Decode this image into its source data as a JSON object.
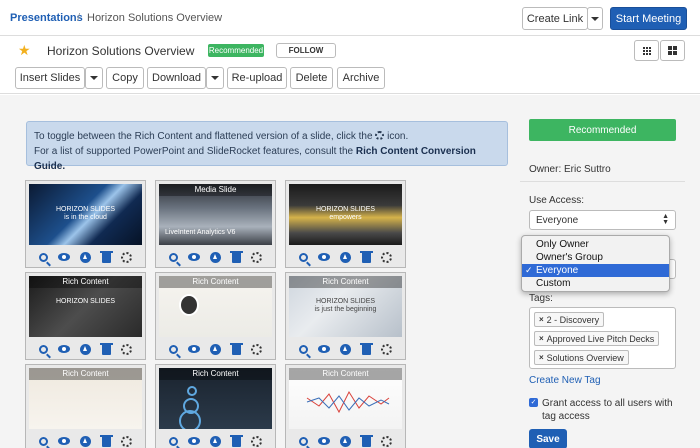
{
  "breadcrumb": {
    "root": "Presentations",
    "separator": "/",
    "current": "Horizon Solutions Overview"
  },
  "header": {
    "create_link": "Create Link",
    "start_meeting": "Start Meeting"
  },
  "presentation": {
    "title": "Horizon Solutions Overview",
    "badge": "Recommended",
    "follow": "FOLLOW"
  },
  "toolbar": {
    "insert_slides": "Insert Slides",
    "copy": "Copy",
    "download": "Download",
    "reupload": "Re-upload",
    "delete": "Delete",
    "archive": "Archive"
  },
  "info": {
    "line1_prefix": "To toggle between the Rich Content and flattened version of a slide, click the",
    "line1_suffix": "icon.",
    "line2_prefix": "For a list of supported PowerPoint and SlideRocket features, consult the",
    "line2_link": "Rich Content Conversion Guide."
  },
  "slides": [
    {
      "label": "",
      "text": "HORIZON SLIDES\nis in the cloud",
      "theme": "blue-motion"
    },
    {
      "label": "Media Slide",
      "text": "LiveIntent Analytics V6",
      "theme": "people"
    },
    {
      "label": "",
      "text": "HORIZON SLIDES\nempowers",
      "theme": "gold"
    },
    {
      "label": "Rich Content",
      "text": "HORIZON SLIDES",
      "theme": "dark-room"
    },
    {
      "label": "Rich Content",
      "text": "",
      "theme": "profile"
    },
    {
      "label": "Rich Content",
      "text": "HORIZON SLIDES\nis just the beginning",
      "theme": "blur"
    },
    {
      "label": "Rich Content",
      "text": "",
      "theme": "doc"
    },
    {
      "label": "Rich Content",
      "text": "",
      "theme": "dark-chart"
    },
    {
      "label": "Rich Content",
      "text": "",
      "theme": "line-chart"
    }
  ],
  "panel": {
    "recommended": "Recommended",
    "owner": "Owner: Eric Suttro",
    "use_access_label": "Use Access:",
    "use_access_value": "Everyone",
    "dropdown_options": [
      "Only Owner",
      "Owner's Group",
      "Everyone",
      "Custom"
    ],
    "dropdown_selected": "Everyone",
    "check_mark": "✓",
    "tags_label": "Tags:",
    "tag_remove": "×",
    "tags": [
      "2 - Discovery",
      "Approved Live Pitch Decks",
      "Solutions Overview"
    ],
    "create_tag": "Create New Tag",
    "grant_check": "✓",
    "grant_text": "Grant access to all users with tag access",
    "save": "Save"
  },
  "colors": {
    "primary": "#1f5fb4",
    "success": "#3db561",
    "info_bg": "#c9d9ec",
    "star": "#f2b01e"
  }
}
